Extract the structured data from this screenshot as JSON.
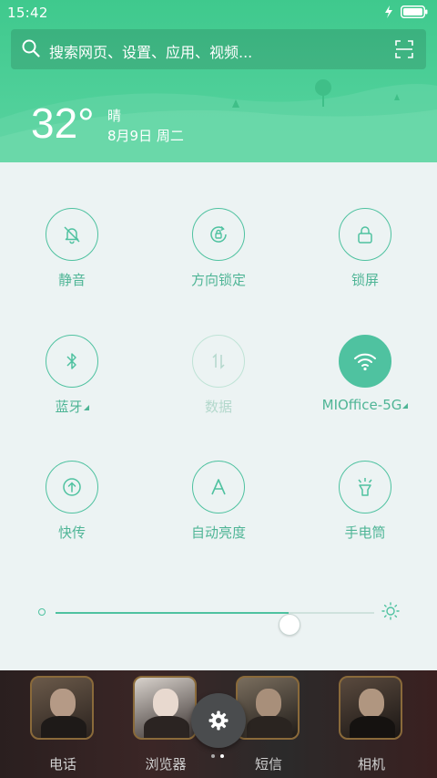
{
  "status_bar": {
    "time": "15:42"
  },
  "search": {
    "placeholder": "搜索网页、设置、应用、视频..."
  },
  "weather": {
    "temperature": "32°",
    "condition": "晴",
    "date": "8月9日 周二"
  },
  "quick_settings": [
    {
      "label": "静音",
      "icon": "bell-off-icon",
      "state": "off"
    },
    {
      "label": "方向锁定",
      "icon": "rotation-lock-icon",
      "state": "off"
    },
    {
      "label": "锁屏",
      "icon": "lock-icon",
      "state": "off"
    },
    {
      "label": "蓝牙",
      "icon": "bluetooth-icon",
      "state": "off",
      "has_menu": true
    },
    {
      "label": "数据",
      "icon": "mobile-data-icon",
      "state": "disabled"
    },
    {
      "label": "MIOffice-5G",
      "icon": "wifi-icon",
      "state": "on",
      "has_menu": true
    },
    {
      "label": "快传",
      "icon": "share-transfer-icon",
      "state": "off"
    },
    {
      "label": "自动亮度",
      "icon": "auto-brightness-icon",
      "state": "off"
    },
    {
      "label": "手电筒",
      "icon": "flashlight-icon",
      "state": "off"
    }
  ],
  "brightness": {
    "level": 0.73
  },
  "home": {
    "apps": [
      {
        "label": "电话"
      },
      {
        "label": "浏览器"
      },
      {
        "label": "短信"
      },
      {
        "label": "相机"
      }
    ],
    "page_count": 2,
    "current_page": 2
  },
  "colors": {
    "accent": "#4fc2a0",
    "header_green": "#4dcf98",
    "panel_bg": "#ecf3f3"
  }
}
